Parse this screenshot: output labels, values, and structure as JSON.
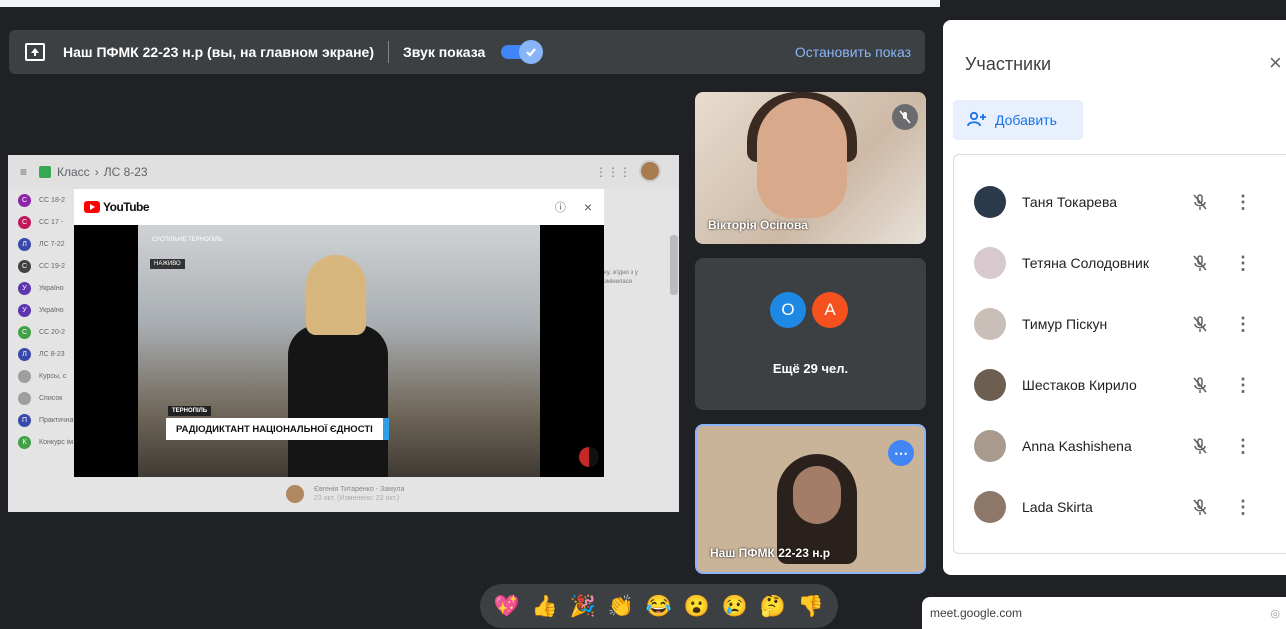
{
  "presentation_bar": {
    "title": "Наш ПФМК 22-23 н.р (вы, на главном экране)",
    "sound_label": "Звук показа",
    "sound_enabled": true,
    "stop_label": "Остановить показ"
  },
  "shared_screen": {
    "breadcrumb_app": "Класс",
    "breadcrumb_sep": "›",
    "breadcrumb_class": "ЛС 8-23",
    "side_items": [
      {
        "letter": "С",
        "label": "СС 18-2",
        "color": "#8e24aa"
      },
      {
        "letter": "С",
        "label": "СС 17 -",
        "color": "#c2185b"
      },
      {
        "letter": "Л",
        "label": "ЛС 7-22",
        "color": "#3949ab"
      },
      {
        "letter": "С",
        "label": "СС 19-2",
        "color": "#424242"
      },
      {
        "letter": "У",
        "label": "Україно",
        "color": "#5e35b1"
      },
      {
        "letter": "У",
        "label": "Україно",
        "color": "#5e35b1"
      },
      {
        "letter": "С",
        "label": "СС 20-2",
        "color": "#43a047"
      },
      {
        "letter": "Л",
        "label": "ЛС 8-23",
        "color": "#3949ab"
      },
      {
        "letter": "",
        "label": "Курсы, с",
        "color": "#9e9e9e"
      },
      {
        "letter": "",
        "label": "Список",
        "color": "#9e9e9e"
      },
      {
        "letter": "П",
        "label": "Практична література СС 17-22",
        "color": "#3949ab"
      },
      {
        "letter": "К",
        "label": "Конкурс ім. П.Яцика",
        "color": "#43a047"
      }
    ],
    "content_snippet": "ку, згідно з у змінилася",
    "bottom_author": "Євгенія Титаренко - Замула",
    "bottom_date": "23 окт. (Изменено: 23 окт.)",
    "youtube": {
      "brand": "YouTube",
      "help_icon": "help-icon",
      "close_symbol": "×",
      "channel_logo": "СУСПІЛЬНЕ ТЕРНОПІЛЬ",
      "live_tag": "НАЖИВО",
      "location": "ТЕРНОПІЛЬ",
      "headline": "РАДІОДИКТАНТ НАЦІОНАЛЬНОЇ ЄДНОСТІ"
    }
  },
  "tiles": {
    "tile1_name": "Вікторія Осіпова",
    "tile2_avatars": [
      {
        "letter": "О",
        "color": "#1e88e5"
      },
      {
        "letter": "А",
        "color": "#f4511e"
      }
    ],
    "tile2_more": "Ещё 29 чел.",
    "tile3_name": "Наш ПФМК 22-23 н.р"
  },
  "participants_panel": {
    "title": "Участники",
    "close_symbol": "×",
    "add_label": "Добавить",
    "people": [
      {
        "name": "Таня Токарева",
        "avatar_color": "#2b3a4a"
      },
      {
        "name": "Тетяна Солодовник",
        "avatar_color": "#d8c9cf"
      },
      {
        "name": "Тимур Піскун",
        "avatar_color": "#c9bfb8"
      },
      {
        "name": "Шестаков Кирило",
        "avatar_color": "#6d5f50"
      },
      {
        "name": "Anna Kashishena",
        "avatar_color": "#a89a8c"
      },
      {
        "name": "Lada Skirta",
        "avatar_color": "#8d7768"
      }
    ]
  },
  "reactions": [
    "💖",
    "👍",
    "🎉",
    "👏",
    "😂",
    "😮",
    "😢",
    "🤔",
    "👎"
  ],
  "url_bar": {
    "url": "meet.google.com"
  },
  "colors": {
    "background": "#202124",
    "accent": "#8ab4f8",
    "panel": "#ffffff"
  }
}
